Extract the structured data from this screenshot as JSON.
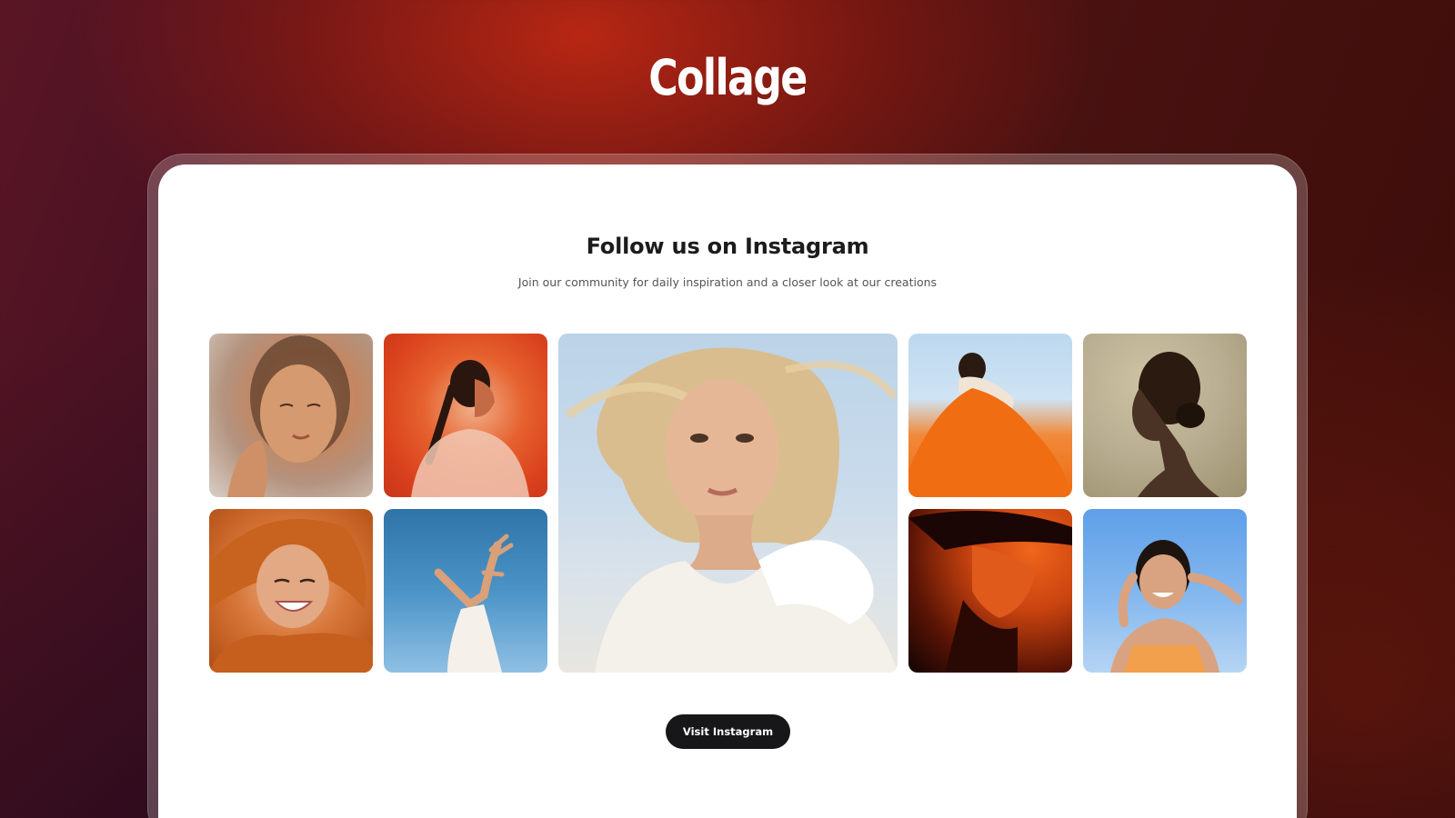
{
  "page": {
    "title": "Collage"
  },
  "section": {
    "title": "Follow us on Instagram",
    "subtitle": "Join our community for daily inspiration and a closer look at our creations",
    "button_label": "Visit Instagram"
  },
  "gallery": {
    "photos": [
      {
        "subject": "woman with eyes closed touching face, glowing skin"
      },
      {
        "subject": "profile of woman with braid against orange background"
      },
      {
        "subject": "blonde woman with windblown hair in white ruffled dress"
      },
      {
        "subject": "woman in flowing orange fabric against sky"
      },
      {
        "subject": "profile silhouette of woman with hair bun"
      },
      {
        "subject": "smiling woman in orange hooded sweater"
      },
      {
        "subject": "hands raised against blue sky"
      },
      {
        "subject": "face in orange shadow with hat"
      },
      {
        "subject": "smiling woman with hands near face against blue sky"
      }
    ]
  },
  "colors": {
    "card_background": "#ffffff",
    "button_background": "#17171a",
    "title_text": "#ffffff",
    "accent_red": "#b3220f"
  }
}
